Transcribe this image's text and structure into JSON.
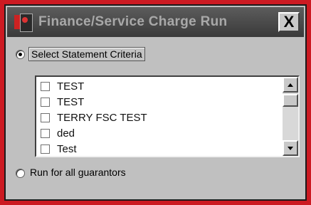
{
  "window": {
    "title": "Finance/Service Charge Run",
    "close_label": "X",
    "background_color": "#cc1a22"
  },
  "options": {
    "select_criteria": {
      "label": "Select Statement Criteria",
      "selected": true
    },
    "all_guarantors": {
      "label": "Run for all guarantors",
      "selected": false
    }
  },
  "criteria_list": {
    "items": [
      {
        "label": "TEST",
        "checked": false
      },
      {
        "label": "TEST",
        "checked": false
      },
      {
        "label": "TERRY FSC TEST",
        "checked": false
      },
      {
        "label": "ded",
        "checked": false
      },
      {
        "label": "Test",
        "checked": false
      }
    ]
  },
  "icons": {
    "app": "app-icon",
    "close": "close-icon",
    "scroll_up": "arrow-up-icon",
    "scroll_down": "arrow-down-icon"
  }
}
